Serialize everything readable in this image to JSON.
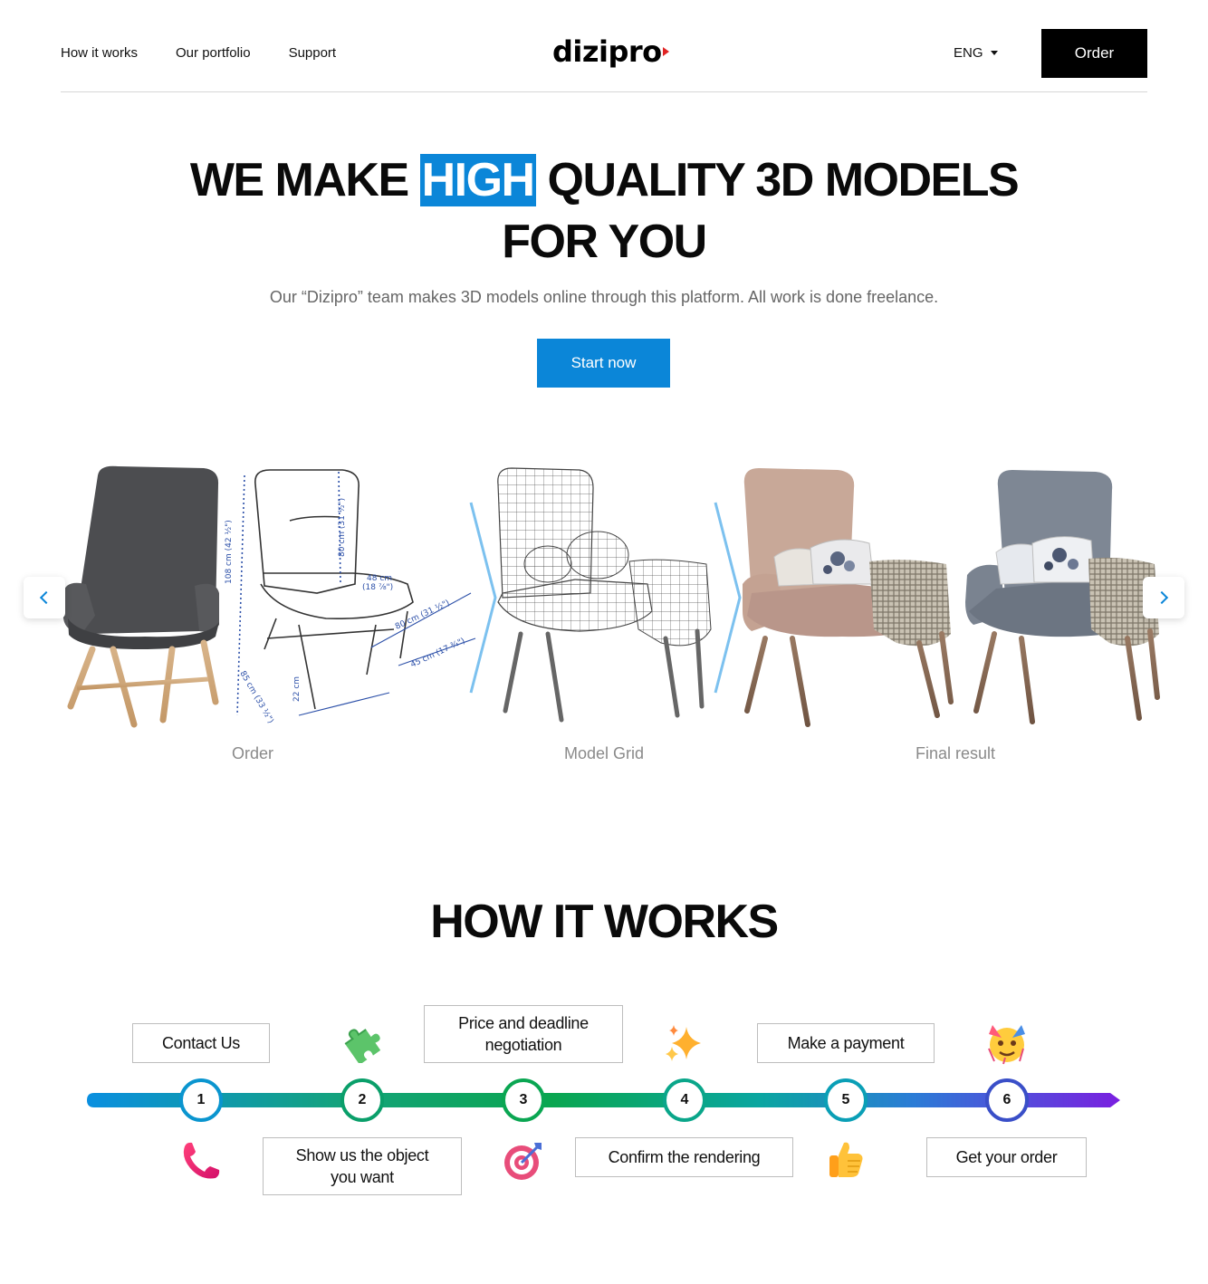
{
  "header": {
    "nav": [
      "How it works",
      "Our portfolio",
      "Support"
    ],
    "logo": "dizipro",
    "language": "ENG",
    "order_label": "Order"
  },
  "hero": {
    "title_before": "WE MAKE ",
    "title_highlight": "HIGH",
    "title_after": " QUALITY 3D MODELS",
    "title_line2": "FOR YOU",
    "subtitle": "Our “Dizipro” team makes 3D models online through this platform. All work is done freelance.",
    "cta_label": "Start now",
    "accent_color": "#0b86d8"
  },
  "showcase": {
    "captions": [
      "Order",
      "Model Grid",
      "Final result"
    ]
  },
  "how_it_works": {
    "title": "HOW IT WORKS",
    "steps": [
      {
        "number": "1",
        "label": "Contact Us",
        "icon": "telephone-icon"
      },
      {
        "number": "2",
        "label": "Show us the object you want",
        "icon": "puzzle-piece-icon"
      },
      {
        "number": "3",
        "label": "Price and deadline negotiation",
        "icon": "target-icon"
      },
      {
        "number": "4",
        "label": "Confirm the rendering",
        "icon": "sparkles-icon"
      },
      {
        "number": "5",
        "label": "Make a payment",
        "icon": "thumbs-up-icon"
      },
      {
        "number": "6",
        "label": "Get your order",
        "icon": "party-face-icon"
      }
    ]
  }
}
